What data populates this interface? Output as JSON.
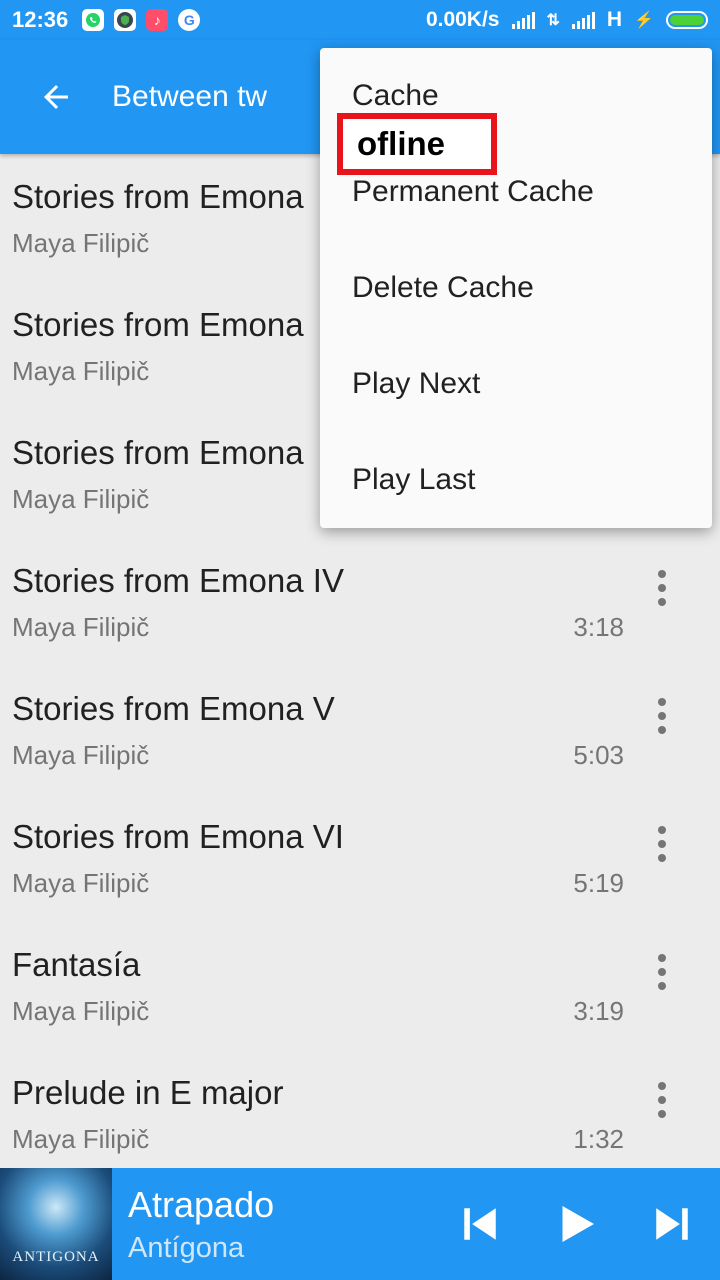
{
  "status_bar": {
    "time": "12:36",
    "network_speed": "0.00K/s",
    "network_type": "H",
    "notification_icons": [
      "whatsapp-icon",
      "vpn-icon",
      "tiktok-icon",
      "google-icon"
    ]
  },
  "header": {
    "title": "Between tw",
    "back_icon": "arrow-left-icon"
  },
  "tracks": [
    {
      "title": "Stories from Emona",
      "artist": "Maya Filipič",
      "duration": ""
    },
    {
      "title": "Stories from Emona",
      "artist": "Maya Filipič",
      "duration": ""
    },
    {
      "title": "Stories from Emona",
      "artist": "Maya Filipič",
      "duration": ""
    },
    {
      "title": "Stories from Emona IV",
      "artist": "Maya Filipič",
      "duration": "3:18"
    },
    {
      "title": "Stories from Emona V",
      "artist": "Maya Filipič",
      "duration": "5:03"
    },
    {
      "title": "Stories from Emona VI",
      "artist": "Maya Filipič",
      "duration": "5:19"
    },
    {
      "title": "Fantasía",
      "artist": "Maya Filipič",
      "duration": "3:19"
    },
    {
      "title": "Prelude in E major",
      "artist": "Maya Filipič",
      "duration": "1:32"
    }
  ],
  "context_menu": {
    "items": [
      "Cache",
      "Permanent Cache",
      "Delete Cache",
      "Play Next",
      "Play Last"
    ]
  },
  "annotation": {
    "label": "ofline",
    "color": "#e8141c"
  },
  "player": {
    "title": "Atrapado",
    "artist": "Antígona",
    "cover_text": "ANTIGONA"
  },
  "colors": {
    "primary": "#2196f3",
    "background": "#ececec"
  }
}
